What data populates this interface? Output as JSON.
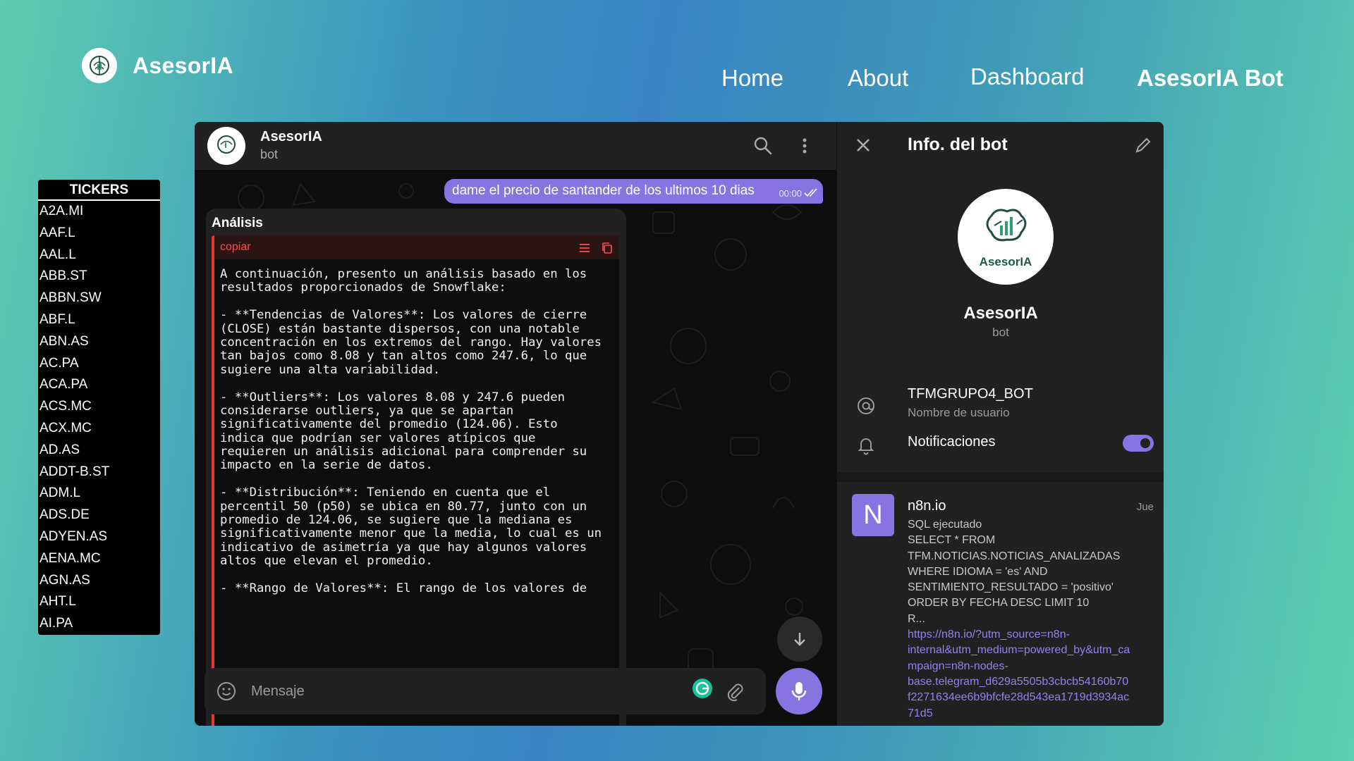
{
  "brand": {
    "name": "AsesorIA"
  },
  "nav": {
    "items": [
      "Home",
      "About",
      "Dashboard",
      "AsesorIA Bot"
    ]
  },
  "tickers": {
    "header": "TICKERS",
    "items": [
      "A2A.MI",
      "AAF.L",
      "AAL.L",
      "ABB.ST",
      "ABBN.SW",
      "ABF.L",
      "ABN.AS",
      "AC.PA",
      "ACA.PA",
      "ACS.MC",
      "ACX.MC",
      "AD.AS",
      "ADDT-B.ST",
      "ADM.L",
      "ADS.DE",
      "ADYEN.AS",
      "AENA.MC",
      "AGN.AS",
      "AHT.L",
      "AI.PA"
    ]
  },
  "chat": {
    "title": "AsesorIA",
    "subtitle": "bot",
    "outgoing": {
      "text": "dame el precio de santander de los ultimos 10 dias",
      "time": "00:00"
    },
    "incoming": {
      "title": "Análisis",
      "code_label": "copiar",
      "lines": [
        "A continuación, presento un análisis basado en los",
        "resultados proporcionados de Snowflake:",
        "",
        "- **Tendencias de Valores**: Los valores de cierre",
        "(CLOSE) están bastante dispersos, con una notable",
        "concentración en los extremos del rango. Hay valores",
        "tan bajos como 8.08 y tan altos como 247.6, lo que",
        "sugiere una alta variabilidad.",
        "",
        "- **Outliers**: Los valores 8.08 y 247.6 pueden",
        "considerarse outliers, ya que se apartan",
        "significativamente del promedio (124.06). Esto",
        "indica que podrían ser valores atípicos que",
        "requieren un análisis adicional para comprender su",
        "impacto en la serie de datos.",
        "",
        "- **Distribución**: Teniendo en cuenta que el",
        "percentil 50 (p50) se ubica en 80.77, junto con un",
        "promedio de 124.06, se sugiere que la mediana es",
        "significativamente menor que la media, lo cual es un",
        "indicativo de asimetría ya que hay algunos valores",
        "altos que elevan el promedio.",
        "",
        "- **Rango de Valores**: El rango de los valores de"
      ]
    },
    "composer": {
      "placeholder": "Mensaje"
    }
  },
  "info": {
    "title": "Info. del bot",
    "avatar_label": "AsesorIA",
    "name": "AsesorIA",
    "subtitle": "bot",
    "username": "TFMGRUPO4_BOT",
    "username_caption": "Nombre de usuario",
    "notifications_label": "Notificaciones",
    "notifications_on": true,
    "notification": {
      "avatar_letter": "N",
      "sender": "n8n.io",
      "day": "Jue",
      "lines": [
        "SQL ejecutado",
        "SELECT * FROM",
        "TFM.NOTICIAS.NOTICIAS_ANALIZADAS",
        "WHERE IDIOMA = 'es' AND",
        "SENTIMIENTO_RESULTADO = 'positivo'",
        "ORDER BY FECHA DESC LIMIT 10",
        "R..."
      ],
      "link_lines": [
        "https://n8n.io/?utm_source=n8n-",
        "internal&utm_medium=powered_by&utm_ca",
        "mpaign=n8n-nodes-",
        "base.telegram_d629a5505b3cbcb54160b70",
        "f2271634ee6b9bfcfe28d543ea1719d3934ac",
        "71d5"
      ]
    }
  },
  "colors": {
    "accent": "#8774e1",
    "code_border": "#e53935",
    "panel": "#212121"
  }
}
